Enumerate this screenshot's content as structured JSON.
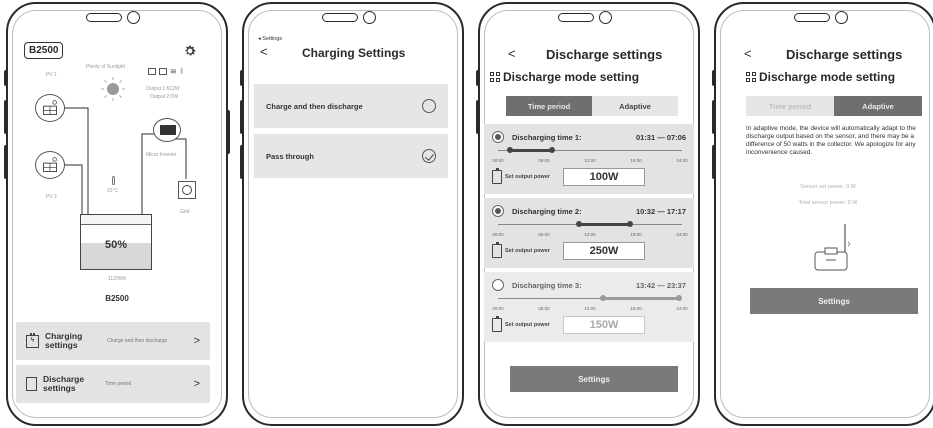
{
  "screen1": {
    "model": "B2500",
    "sunlight_label": "Plenty of Sunlight",
    "pv1_label": "PV 1",
    "pv2_label": "PV 2",
    "output1": "Output 1:512W",
    "output2": "Output 2:0W",
    "inverter_label": "Micro Inverter",
    "temperature": "22°C",
    "grid_label": "Grid",
    "battery_percent": "50%",
    "capacity": "1120Wh",
    "device_name": "B2500",
    "charging_label": "Charging settings",
    "charging_value": "Charge and then discharge",
    "discharge_label": "Discharge settings",
    "discharge_value": "Time period",
    "chevron": ">"
  },
  "screen2": {
    "breadcrumb": "◂ Settings",
    "back": "<",
    "title": "Charging Settings",
    "options": [
      {
        "label": "Charge and then discharge",
        "selected": false
      },
      {
        "label": "Pass through",
        "selected": true
      }
    ]
  },
  "screen3": {
    "back": "<",
    "title": "Discharge settings",
    "section_title": "Discharge mode setting",
    "tabs": [
      "Time period",
      "Adaptive"
    ],
    "active_tab": 0,
    "ticks": [
      "00:00",
      "06:00",
      "12:00",
      "18:00",
      "24:00"
    ],
    "power_label": "Set output power",
    "slots": [
      {
        "name": "Discharging time 1:",
        "start": "01:31",
        "end": "07:06",
        "dash": "—",
        "power": "100W",
        "enabled": true,
        "start_frac": 0.063,
        "end_frac": 0.296
      },
      {
        "name": "Discharging time 2:",
        "start": "10:32",
        "end": "17:17",
        "dash": "—",
        "power": "250W",
        "enabled": true,
        "start_frac": 0.439,
        "end_frac": 0.72
      },
      {
        "name": "Discharging time 3:",
        "start": "13:42",
        "end": "23:37",
        "dash": "—",
        "power": "150W",
        "enabled": false,
        "start_frac": 0.571,
        "end_frac": 0.984
      }
    ],
    "button": "Settings"
  },
  "screen4": {
    "back": "<",
    "title": "Discharge settings",
    "section_title": "Discharge mode setting",
    "tabs": [
      "Time period",
      "Adaptive"
    ],
    "active_tab": 1,
    "description": "In adaptive mode, the device will automatically adapt to the discharge output based on the sensor, and there may be a difference of 50 watts in the collector. We apologize for any inconvenience caused.",
    "sensor_power": "Sensor set power: 0 W",
    "total_power": "Total sensor power: 0 W",
    "button": "Settings"
  },
  "colors": {
    "accent": "#6f6f6f",
    "card": "#e3e3e3",
    "frame": "#2a2a2a"
  }
}
